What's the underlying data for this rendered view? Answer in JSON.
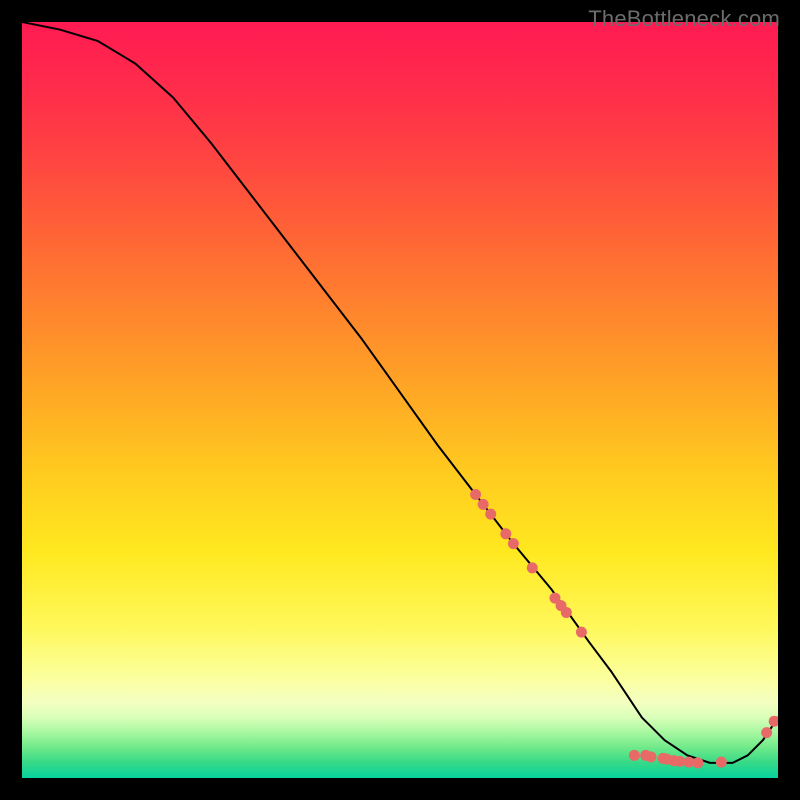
{
  "watermark": "TheBottleneck.com",
  "chart_data": {
    "type": "line",
    "title": "",
    "xlabel": "",
    "ylabel": "",
    "xlim": [
      0,
      100
    ],
    "ylim": [
      0,
      100
    ],
    "grid": false,
    "series": [
      {
        "name": "curve",
        "color": "#000000",
        "x": [
          0,
          5,
          10,
          15,
          20,
          25,
          30,
          35,
          40,
          45,
          50,
          55,
          60,
          65,
          70,
          75,
          78,
          80,
          82,
          83,
          85,
          88,
          91,
          92,
          94,
          96,
          98,
          100
        ],
        "y": [
          100,
          99,
          97.5,
          94.5,
          90,
          84,
          77.5,
          71,
          64.5,
          58,
          51,
          44,
          37.5,
          31,
          25,
          18,
          14,
          11,
          8,
          7,
          5,
          3,
          2,
          2,
          2,
          3,
          5,
          8
        ]
      }
    ],
    "scatter": [
      {
        "name": "markers",
        "color": "#e86a67",
        "radius_px": 5.5,
        "points": [
          {
            "x": 60.0,
            "y": 37.5
          },
          {
            "x": 61.0,
            "y": 36.2
          },
          {
            "x": 62.0,
            "y": 34.9
          },
          {
            "x": 64.0,
            "y": 32.3
          },
          {
            "x": 65.0,
            "y": 31.0
          },
          {
            "x": 67.5,
            "y": 27.8
          },
          {
            "x": 70.5,
            "y": 23.8
          },
          {
            "x": 71.3,
            "y": 22.8
          },
          {
            "x": 72.0,
            "y": 21.9
          },
          {
            "x": 74.0,
            "y": 19.3
          },
          {
            "x": 81.0,
            "y": 3.0
          },
          {
            "x": 82.5,
            "y": 3.0
          },
          {
            "x": 83.2,
            "y": 2.8
          },
          {
            "x": 84.8,
            "y": 2.6
          },
          {
            "x": 85.3,
            "y": 2.5
          },
          {
            "x": 86.2,
            "y": 2.3
          },
          {
            "x": 87.0,
            "y": 2.2
          },
          {
            "x": 88.2,
            "y": 2.1
          },
          {
            "x": 89.4,
            "y": 2.0
          },
          {
            "x": 92.5,
            "y": 2.1
          },
          {
            "x": 98.5,
            "y": 6.0
          },
          {
            "x": 99.5,
            "y": 7.5
          }
        ]
      }
    ]
  }
}
